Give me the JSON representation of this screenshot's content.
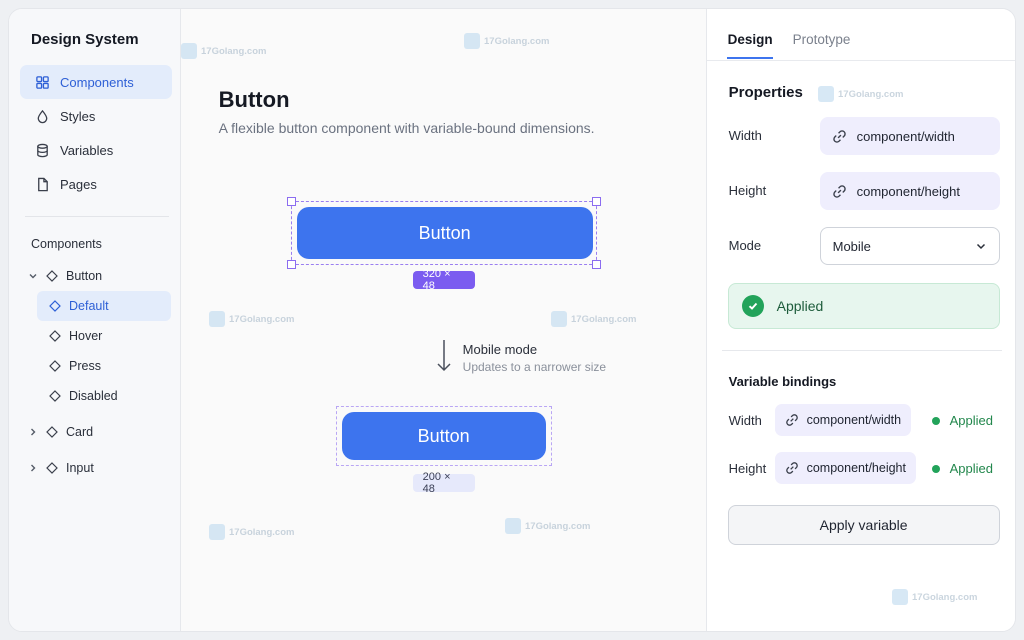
{
  "sidebar": {
    "title": "Design System",
    "nav": [
      {
        "label": "Components",
        "icon": "grid-icon",
        "active": true
      },
      {
        "label": "Styles",
        "icon": "drop-icon",
        "active": false
      },
      {
        "label": "Variables",
        "icon": "database-icon",
        "active": false
      },
      {
        "label": "Pages",
        "icon": "page-icon",
        "active": false
      }
    ],
    "section_label": "Components",
    "tree": {
      "button": "Button",
      "default": "Default",
      "hover": "Hover",
      "press": "Press",
      "disabled": "Disabled",
      "card": "Card",
      "input": "Input"
    }
  },
  "canvas": {
    "title": "Button",
    "subtitle": "A flexible button component with variable-bound dimensions.",
    "primary_button_label": "Button",
    "primary_dimensions": "320 × 48",
    "mode_title": "Mobile mode",
    "mode_subtitle": "Updates to a narrower size",
    "secondary_button_label": "Button",
    "secondary_dimensions": "200 × 48"
  },
  "panel": {
    "tabs": [
      "Design",
      "Prototype"
    ],
    "active_tab": "Design",
    "properties_title": "Properties",
    "width_label": "Width",
    "width_value": "component/width",
    "height_label": "Height",
    "height_value": "component/height",
    "mode_label": "Mode",
    "mode_value": "Mobile",
    "applied_text": "Applied",
    "bindings_title": "Variable bindings",
    "bindings": [
      {
        "label": "Width",
        "value": "component/width",
        "status": "Applied"
      },
      {
        "label": "Height",
        "value": "component/height",
        "status": "Applied"
      }
    ],
    "apply_button": "Apply variable"
  },
  "watermark": "17Golang.com",
  "colors": {
    "accent": "#3d74ee",
    "selection": "#8b6cf0",
    "success": "#22a35a",
    "chip_bg": "#efeefd"
  }
}
